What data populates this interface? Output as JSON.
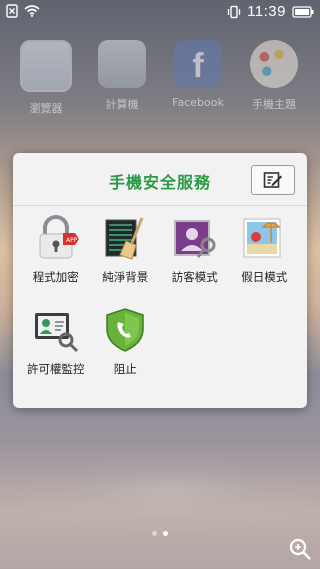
{
  "statusbar": {
    "time": "11:39"
  },
  "desktop": {
    "apps": [
      {
        "label": "瀏覽器",
        "icon": "browser-icon"
      },
      {
        "label": "計算機",
        "icon": "calculator-icon"
      },
      {
        "label": "Facebook",
        "icon": "facebook-icon"
      },
      {
        "label": "手機主題",
        "icon": "theme-icon"
      }
    ]
  },
  "folder": {
    "title": "手機安全服務",
    "edit_icon": "edit-icon",
    "apps": [
      {
        "label": "程式加密",
        "icon": "app-lock-icon"
      },
      {
        "label": "純淨背景",
        "icon": "clean-background-icon"
      },
      {
        "label": "訪客模式",
        "icon": "guest-mode-icon"
      },
      {
        "label": "假日模式",
        "icon": "holiday-mode-icon"
      },
      {
        "label": "許可權監控",
        "icon": "permission-monitor-icon"
      },
      {
        "label": "阻止",
        "icon": "block-icon"
      }
    ]
  },
  "colors": {
    "title_green": "#2a9a45",
    "panel_bg": "#f2f2f2"
  }
}
